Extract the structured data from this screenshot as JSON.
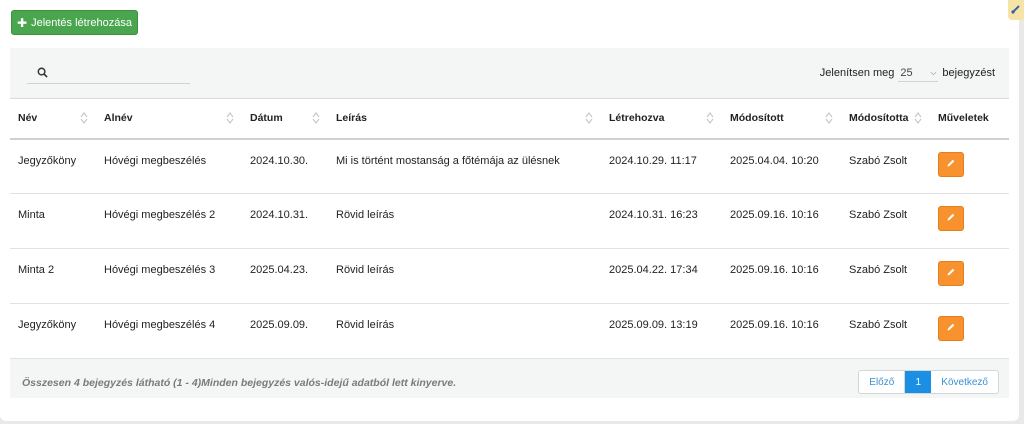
{
  "toolbar": {
    "create_label": "Jelentés létrehozása"
  },
  "search": {
    "value": "",
    "placeholder": ""
  },
  "length": {
    "prefix": "Jelenítsen meg",
    "value": "25",
    "suffix": "bejegyzést"
  },
  "table": {
    "columns": [
      "Név",
      "Alnév",
      "Dátum",
      "Leírás",
      "Létrehozva",
      "Módosított",
      "Módosította",
      "Műveletek"
    ],
    "rows": [
      [
        "Jegyzőköny",
        "Hóvégi megbeszélés",
        "2024.10.30.",
        "Mi is történt mostanság a főtémája az ülésnek",
        "2024.10.29. 11:17",
        "2025.04.04. 10:20",
        "Szabó Zsolt"
      ],
      [
        "Minta",
        "Hóvégi megbeszélés 2",
        "2024.10.31.",
        "Rövid leírás",
        "2024.10.31. 16:23",
        "2025.09.16. 10:16",
        "Szabó Zsolt"
      ],
      [
        "Minta 2",
        "Hóvégi megbeszélés 3",
        "2025.04.23.",
        "Rövid leírás",
        "2025.04.22. 17:34",
        "2025.09.16. 10:16",
        "Szabó Zsolt"
      ],
      [
        "Jegyzőköny",
        "Hóvégi megbeszélés 4",
        "2025.09.09.",
        "Rövid leírás",
        "2025.09.09. 13:19",
        "2025.09.16. 10:16",
        "Szabó Zsolt"
      ]
    ]
  },
  "footer": {
    "info": "Összesen 4 bejegyzés látható (1 - 4)Minden bejegyzés valós-idejű adatból lett kinyerve.",
    "prev": "Előző",
    "page": "1",
    "next": "Következő"
  },
  "colors": {
    "create_button": "#4aa64e",
    "edit_button": "#f7922e",
    "active_page": "#1a8fe3"
  }
}
